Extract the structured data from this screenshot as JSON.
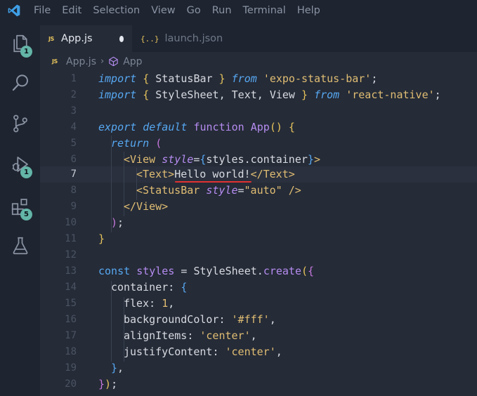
{
  "menu": [
    "File",
    "Edit",
    "Selection",
    "View",
    "Go",
    "Run",
    "Terminal",
    "Help"
  ],
  "activity": {
    "explorer_badge": "1",
    "debug_badge": "1",
    "extensions_badge": "5"
  },
  "tabs": [
    {
      "label": "App.js",
      "icon": "JS",
      "dirty": true
    },
    {
      "label": "launch.json",
      "icon": "{..}"
    }
  ],
  "breadcrumb": {
    "file": "App.js",
    "symbol": "App",
    "file_icon": "JS"
  },
  "editor": {
    "current_line": 7,
    "lines": [
      {
        "n": "1"
      },
      {
        "n": "2"
      },
      {
        "n": "3"
      },
      {
        "n": "4"
      },
      {
        "n": "5"
      },
      {
        "n": "6"
      },
      {
        "n": "7"
      },
      {
        "n": "8"
      },
      {
        "n": "9"
      },
      {
        "n": "10"
      },
      {
        "n": "11"
      },
      {
        "n": "12"
      },
      {
        "n": "13"
      },
      {
        "n": "14"
      },
      {
        "n": "15"
      },
      {
        "n": "16"
      },
      {
        "n": "17"
      },
      {
        "n": "18"
      },
      {
        "n": "19"
      },
      {
        "n": "20"
      }
    ],
    "code": {
      "l1": [
        "import",
        " { ",
        "StatusBar",
        " } ",
        "from",
        " ",
        "'expo-status-bar'",
        ";"
      ],
      "l2": [
        "import",
        " { ",
        "StyleSheet, Text, View",
        " } ",
        "from",
        " ",
        "'react-native'",
        ";"
      ],
      "l4": [
        "export",
        " ",
        "default",
        " ",
        "function",
        " ",
        "App",
        "() {"
      ],
      "l5": [
        "return",
        " ("
      ],
      "l6": [
        "<View",
        " ",
        "style",
        "=",
        "{",
        "styles.container",
        "}",
        ">"
      ],
      "l7": [
        "<Text>",
        "Hello world!",
        "</Text>"
      ],
      "l8": [
        "<StatusBar",
        " ",
        "style",
        "=",
        "\"auto\"",
        " />"
      ],
      "l9": [
        "</View>"
      ],
      "l10": [
        ")",
        ";"
      ],
      "l11": [
        "}"
      ],
      "l13": [
        "const",
        " ",
        "styles",
        " = ",
        "StyleSheet",
        ".",
        "create",
        "(",
        "{"
      ],
      "l14": [
        "container",
        ": ",
        "{"
      ],
      "l15": [
        "flex",
        ": ",
        "1",
        ","
      ],
      "l16": [
        "backgroundColor",
        ": ",
        "'#fff'",
        ","
      ],
      "l17": [
        "alignItems",
        ": ",
        "'center'",
        ","
      ],
      "l18": [
        "justifyContent",
        ": ",
        "'center'",
        ","
      ],
      "l19": [
        "}",
        ","
      ],
      "l20": [
        "}",
        ")",
        ";"
      ]
    }
  },
  "colors": {
    "keyword": "#57a8f2",
    "string": "#e0bd73",
    "function": "#b58cf0",
    "badge": "#63b5a8",
    "error_squiggle": "#e03232"
  }
}
